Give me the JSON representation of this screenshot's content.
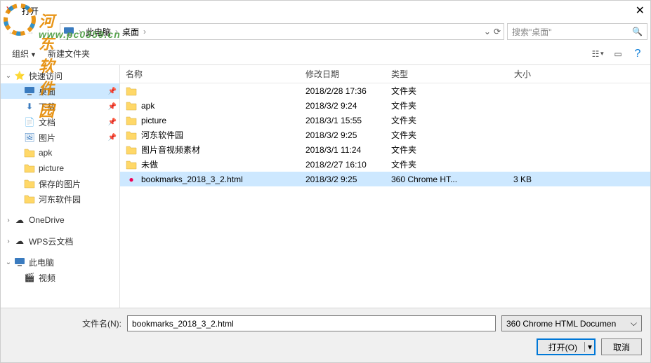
{
  "window": {
    "title": "打开"
  },
  "watermark": {
    "line1": "河东软件园",
    "line2": "www.pc0359.cn"
  },
  "nav": {
    "crumbs": [
      "此电脑",
      "桌面"
    ],
    "search_placeholder": "搜索\"桌面\""
  },
  "toolbar": {
    "organize": "组织",
    "newfolder": "新建文件夹"
  },
  "sidebar": {
    "quick": {
      "label": "快速访问",
      "items": [
        {
          "label": "桌面",
          "icon": "desktop",
          "pin": true,
          "selected": true
        },
        {
          "label": "下载",
          "icon": "download",
          "pin": true
        },
        {
          "label": "文档",
          "icon": "document",
          "pin": true
        },
        {
          "label": "图片",
          "icon": "pictures",
          "pin": true
        },
        {
          "label": "apk",
          "icon": "folder"
        },
        {
          "label": "picture",
          "icon": "folder"
        },
        {
          "label": "保存的图片",
          "icon": "folder"
        },
        {
          "label": "河东软件园",
          "icon": "folder"
        }
      ]
    },
    "onedrive": "OneDrive",
    "wps": "WPS云文档",
    "thispc": {
      "label": "此电脑",
      "items": [
        {
          "label": "视频",
          "icon": "video"
        }
      ]
    }
  },
  "filelist": {
    "headers": {
      "name": "名称",
      "date": "修改日期",
      "type": "类型",
      "size": "大小"
    },
    "rows": [
      {
        "name": "",
        "date": "2018/2/28 17:36",
        "type": "文件夹",
        "size": "",
        "icon": "folder"
      },
      {
        "name": "apk",
        "date": "2018/3/2 9:24",
        "type": "文件夹",
        "size": "",
        "icon": "folder"
      },
      {
        "name": "picture",
        "date": "2018/3/1 15:55",
        "type": "文件夹",
        "size": "",
        "icon": "folder"
      },
      {
        "name": "河东软件园",
        "date": "2018/3/2 9:25",
        "type": "文件夹",
        "size": "",
        "icon": "folder"
      },
      {
        "name": "图片音视频素材",
        "date": "2018/3/1 11:24",
        "type": "文件夹",
        "size": "",
        "icon": "folder"
      },
      {
        "name": "未做",
        "date": "2018/2/27 16:10",
        "type": "文件夹",
        "size": "",
        "icon": "folder"
      },
      {
        "name": "bookmarks_2018_3_2.html",
        "date": "2018/3/2 9:25",
        "type": "360 Chrome HT...",
        "size": "3 KB",
        "icon": "html",
        "selected": true
      }
    ]
  },
  "bottom": {
    "filename_label": "文件名(N):",
    "filename_value": "bookmarks_2018_3_2.html",
    "filter": "360 Chrome HTML Documen",
    "open": "打开(O)",
    "cancel": "取消"
  }
}
